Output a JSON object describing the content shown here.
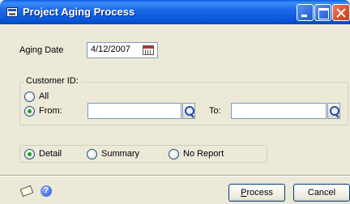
{
  "window": {
    "title": "Project Aging Process"
  },
  "aging_date": {
    "label": "Aging Date",
    "value": "4/12/2007"
  },
  "customer": {
    "legend": "Customer ID:",
    "all_label": "All",
    "from_label": "From:",
    "to_label": "To:",
    "from_value": "",
    "to_value": "",
    "selected": "from"
  },
  "report": {
    "options": [
      {
        "label": "Detail",
        "checked": true
      },
      {
        "label": "Summary",
        "checked": false
      },
      {
        "label": "No Report",
        "checked": false
      }
    ]
  },
  "buttons": {
    "process_mnemonic": "P",
    "process_rest": "rocess",
    "cancel": "Cancel"
  },
  "icons": {
    "title": "window-app-icon",
    "date_picker": "calendar-icon",
    "lookup": "magnifier-lookup-icon",
    "note": "note-icon",
    "help": "help-icon"
  }
}
